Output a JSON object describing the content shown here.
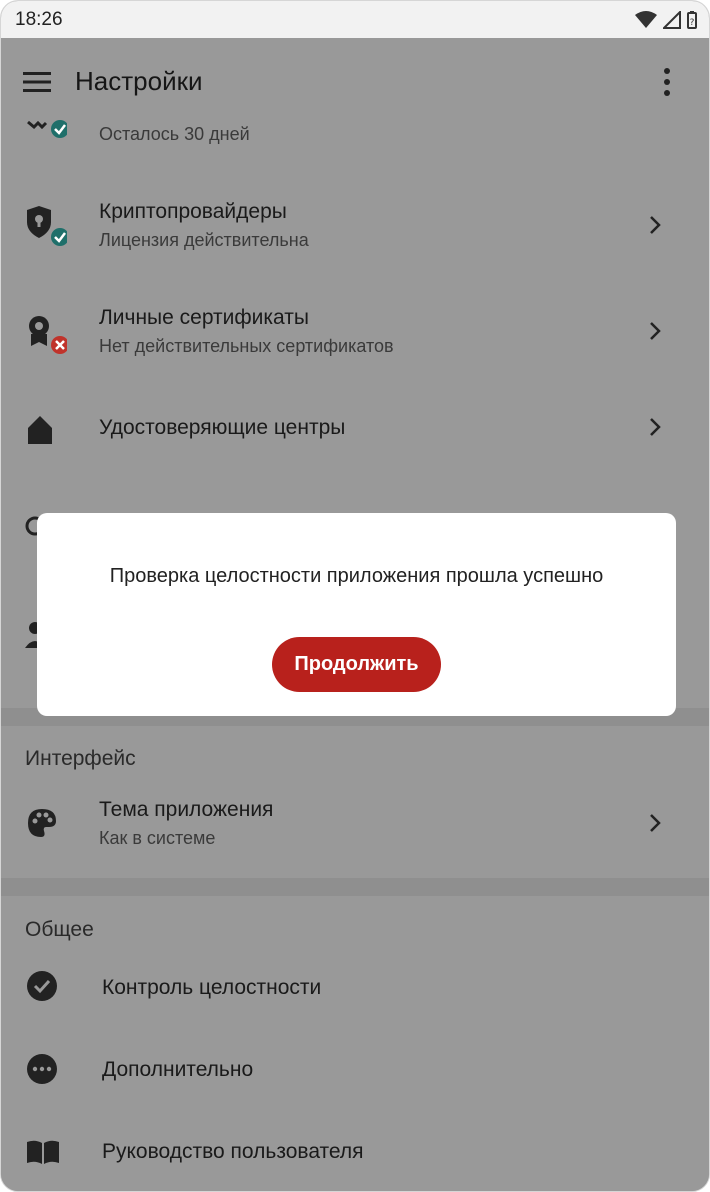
{
  "status_bar": {
    "time": "18:26"
  },
  "app_bar": {
    "title": "Настройки"
  },
  "license_row": {
    "secondary": "Осталось 30 дней"
  },
  "crypto_row": {
    "primary": "Криптопровайдеры",
    "secondary": "Лицензия действительна"
  },
  "certs_row": {
    "primary": "Личные сертификаты",
    "secondary": "Нет действительных сертификатов"
  },
  "ca_row": {
    "primary": "Удостоверяющие центры"
  },
  "interface_section": {
    "title": "Интерфейс"
  },
  "theme_row": {
    "primary": "Тема приложения",
    "secondary": "Как в системе"
  },
  "general_section": {
    "title": "Общее"
  },
  "general_items": [
    {
      "label": "Контроль целостности",
      "icon": "check-circle-icon"
    },
    {
      "label": "Дополнительно",
      "icon": "more-circle-icon"
    },
    {
      "label": "Руководство пользователя",
      "icon": "book-icon"
    }
  ],
  "dialog": {
    "message": "Проверка целостности приложения прошла успешно",
    "continue_label": "Продолжить"
  },
  "colors": {
    "accent": "#b8211c",
    "ok_badge": "#1f6f6a",
    "error_badge": "#c0332b"
  }
}
